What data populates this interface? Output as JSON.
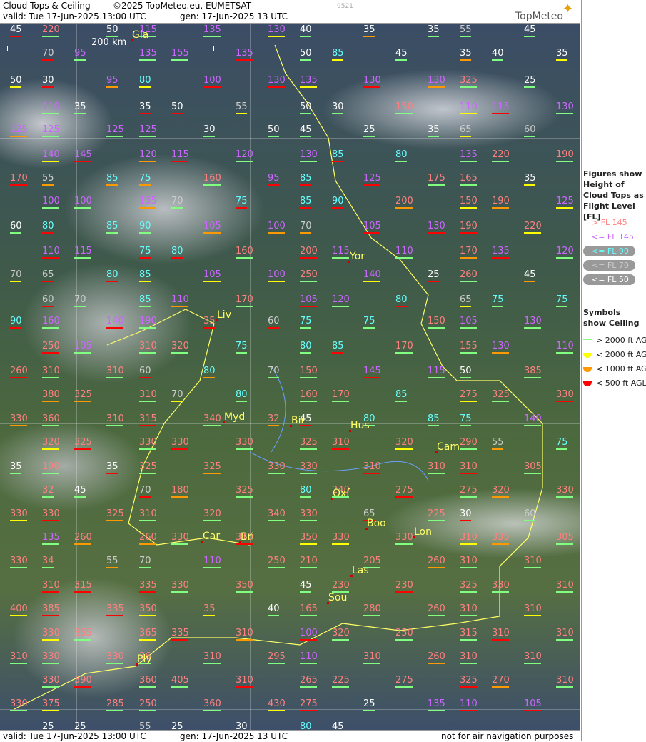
{
  "header": {
    "title": "Cloud Tops & Ceiling",
    "copyright": "©2025 TopMeteo.eu, EUMETSAT",
    "valid": "valid:  Tue  17-Jun-2025  13:00 UTC",
    "gen": "gen: 17-Jun-2025 13 UTC",
    "code": "9521",
    "brand": "TopMeteo"
  },
  "footer": {
    "valid": "valid:  Tue  17-Jun-2025  13:00 UTC",
    "gen": "gen: 17-Jun-2025 13 UTC",
    "note": "not for air navigation purposes"
  },
  "scale": {
    "label": "200 km"
  },
  "legend": {
    "figures_title": "Figures show Height of Cloud Tops as Flight Level  [FL]",
    "symbols_title": "Symbols show Ceiling",
    "fl_items": [
      {
        "label": "> FL 145",
        "color": "#ff8080"
      },
      {
        "label": "<= FL 145",
        "color": "#cc66ff"
      },
      {
        "label": "<= FL 90",
        "color": "#66ffff"
      },
      {
        "label": "<= FL 70",
        "color": "#cccccc"
      },
      {
        "label": "<= FL 50",
        "color": "#ffffff"
      }
    ],
    "ceiling_items": [
      {
        "label": "> 2000 ft AGL",
        "color": "#80ff80"
      },
      {
        "label": "< 2000 ft AGL",
        "color": "#ffff00"
      },
      {
        "label": "< 1000 ft AGL",
        "color": "#ff9900"
      },
      {
        "label": "< 500 ft AGL",
        "color": "#ff0000"
      }
    ]
  },
  "cities": [
    {
      "name": "Gla"
    },
    {
      "name": "Yor"
    },
    {
      "name": "Liv"
    },
    {
      "name": "Myd"
    },
    {
      "name": "Bir"
    },
    {
      "name": "Hus"
    },
    {
      "name": "Cam"
    },
    {
      "name": "Oxf"
    },
    {
      "name": "Car"
    },
    {
      "name": "Bri"
    },
    {
      "name": "Boo"
    },
    {
      "name": "Lon"
    },
    {
      "name": "Las"
    },
    {
      "name": "Sou"
    },
    {
      "name": "Ply"
    }
  ],
  "labels": [
    [
      "45",
      "w"
    ],
    [
      "220",
      "p"
    ],
    [
      "50",
      "w"
    ],
    [
      "115",
      "v"
    ],
    [
      "135",
      "v"
    ],
    [
      "130",
      "v"
    ],
    [
      "40",
      "w"
    ],
    [
      "35",
      "w"
    ],
    [
      "35",
      "w"
    ],
    [
      "55",
      "g"
    ],
    [
      "45",
      "w"
    ],
    [
      "70",
      "g"
    ],
    [
      "95",
      "v"
    ],
    [
      "135",
      "v"
    ],
    [
      "155",
      "v"
    ],
    [
      "135",
      "v"
    ],
    [
      "50",
      "w"
    ],
    [
      "85",
      "c"
    ],
    [
      "45",
      "w"
    ],
    [
      "35",
      "w"
    ],
    [
      "40",
      "w"
    ],
    [
      "35",
      "w"
    ],
    [
      "50",
      "w"
    ],
    [
      "30",
      "w"
    ],
    [
      "95",
      "v"
    ],
    [
      "80",
      "c"
    ],
    [
      "100",
      "v"
    ],
    [
      "130",
      "v"
    ],
    [
      "135",
      "v"
    ],
    [
      "130",
      "v"
    ],
    [
      "130",
      "v"
    ],
    [
      "325",
      "p"
    ],
    [
      "25",
      "w"
    ],
    [
      "110",
      "v"
    ],
    [
      "35",
      "w"
    ],
    [
      "35",
      "w"
    ],
    [
      "50",
      "w"
    ],
    [
      "55",
      "g"
    ],
    [
      "50",
      "w"
    ],
    [
      "30",
      "w"
    ],
    [
      "150",
      "p"
    ],
    [
      "110",
      "v"
    ],
    [
      "115",
      "v"
    ],
    [
      "130",
      "v"
    ],
    [
      "125",
      "v"
    ],
    [
      "125",
      "v"
    ],
    [
      "125",
      "v"
    ],
    [
      "125",
      "v"
    ],
    [
      "30",
      "w"
    ],
    [
      "50",
      "w"
    ],
    [
      "45",
      "w"
    ],
    [
      "25",
      "w"
    ],
    [
      "35",
      "w"
    ],
    [
      "65",
      "g"
    ],
    [
      "60",
      "g"
    ],
    [
      "140",
      "v"
    ],
    [
      "145",
      "v"
    ],
    [
      "120",
      "v"
    ],
    [
      "115",
      "v"
    ],
    [
      "120",
      "v"
    ],
    [
      "130",
      "v"
    ],
    [
      "85",
      "c"
    ],
    [
      "80",
      "c"
    ],
    [
      "135",
      "v"
    ],
    [
      "220",
      "p"
    ],
    [
      "190",
      "p"
    ],
    [
      "170",
      "p"
    ],
    [
      "55",
      "g"
    ],
    [
      "85",
      "c"
    ],
    [
      "75",
      "c"
    ],
    [
      "160",
      "p"
    ],
    [
      "95",
      "v"
    ],
    [
      "85",
      "c"
    ],
    [
      "125",
      "v"
    ],
    [
      "175",
      "p"
    ],
    [
      "165",
      "p"
    ],
    [
      "35",
      "w"
    ],
    [
      "100",
      "v"
    ],
    [
      "100",
      "v"
    ],
    [
      "135",
      "v"
    ],
    [
      "70",
      "g"
    ],
    [
      "75",
      "c"
    ],
    [
      "85",
      "c"
    ],
    [
      "90",
      "c"
    ],
    [
      "200",
      "p"
    ],
    [
      "150",
      "p"
    ],
    [
      "190",
      "p"
    ],
    [
      "125",
      "v"
    ],
    [
      "60",
      "w"
    ],
    [
      "80",
      "c"
    ],
    [
      "85",
      "c"
    ],
    [
      "90",
      "c"
    ],
    [
      "105",
      "v"
    ],
    [
      "100",
      "v"
    ],
    [
      "70",
      "g"
    ],
    [
      "105",
      "v"
    ],
    [
      "130",
      "v"
    ],
    [
      "190",
      "p"
    ],
    [
      "220",
      "p"
    ],
    [
      "110",
      "v"
    ],
    [
      "115",
      "v"
    ],
    [
      "75",
      "c"
    ],
    [
      "80",
      "c"
    ],
    [
      "160",
      "p"
    ],
    [
      "200",
      "p"
    ],
    [
      "115",
      "v"
    ],
    [
      "110",
      "v"
    ],
    [
      "170",
      "p"
    ],
    [
      "135",
      "v"
    ],
    [
      "120",
      "v"
    ],
    [
      "70",
      "g"
    ],
    [
      "65",
      "g"
    ],
    [
      "80",
      "c"
    ],
    [
      "85",
      "c"
    ],
    [
      "105",
      "v"
    ],
    [
      "100",
      "v"
    ],
    [
      "250",
      "p"
    ],
    [
      "140",
      "v"
    ],
    [
      "25",
      "w"
    ],
    [
      "260",
      "p"
    ],
    [
      "45",
      "w"
    ],
    [
      "60",
      "g"
    ],
    [
      "70",
      "g"
    ],
    [
      "85",
      "c"
    ],
    [
      "110",
      "v"
    ],
    [
      "170",
      "p"
    ],
    [
      "105",
      "v"
    ],
    [
      "120",
      "v"
    ],
    [
      "80",
      "c"
    ],
    [
      "65",
      "g"
    ],
    [
      "75",
      "c"
    ],
    [
      "75",
      "c"
    ],
    [
      "90",
      "c"
    ],
    [
      "160",
      "v"
    ],
    [
      "140",
      "v"
    ],
    [
      "190",
      "v"
    ],
    [
      "35",
      "p"
    ],
    [
      "60",
      "g"
    ],
    [
      "75",
      "c"
    ],
    [
      "75",
      "c"
    ],
    [
      "150",
      "p"
    ],
    [
      "105",
      "v"
    ],
    [
      "130",
      "v"
    ],
    [
      "250",
      "p"
    ],
    [
      "105",
      "v"
    ],
    [
      "310",
      "p"
    ],
    [
      "320",
      "p"
    ],
    [
      "75",
      "c"
    ],
    [
      "80",
      "c"
    ],
    [
      "85",
      "c"
    ],
    [
      "170",
      "p"
    ],
    [
      "155",
      "p"
    ],
    [
      "130",
      "v"
    ],
    [
      "110",
      "v"
    ],
    [
      "260",
      "p"
    ],
    [
      "310",
      "p"
    ],
    [
      "310",
      "p"
    ],
    [
      "60",
      "g"
    ],
    [
      "80",
      "c"
    ],
    [
      "70",
      "g"
    ],
    [
      "150",
      "p"
    ],
    [
      "145",
      "v"
    ],
    [
      "115",
      "v"
    ],
    [
      "50",
      "w"
    ],
    [
      "385",
      "p"
    ],
    [
      "380",
      "p"
    ],
    [
      "325",
      "p"
    ],
    [
      "310",
      "p"
    ],
    [
      "70",
      "g"
    ],
    [
      "80",
      "c"
    ],
    [
      "160",
      "p"
    ],
    [
      "170",
      "p"
    ],
    [
      "85",
      "c"
    ],
    [
      "275",
      "p"
    ],
    [
      "325",
      "p"
    ],
    [
      "330",
      "p"
    ],
    [
      "330",
      "p"
    ],
    [
      "360",
      "p"
    ],
    [
      "310",
      "p"
    ],
    [
      "315",
      "p"
    ],
    [
      "340",
      "p"
    ],
    [
      "32",
      "p"
    ],
    [
      "45",
      "w"
    ],
    [
      "80",
      "c"
    ],
    [
      "85",
      "c"
    ],
    [
      "75",
      "c"
    ],
    [
      "140",
      "v"
    ],
    [
      "320",
      "p"
    ],
    [
      "325",
      "p"
    ],
    [
      "330",
      "p"
    ],
    [
      "330",
      "p"
    ],
    [
      "330",
      "p"
    ],
    [
      "325",
      "p"
    ],
    [
      "310",
      "p"
    ],
    [
      "320",
      "p"
    ],
    [
      "290",
      "p"
    ],
    [
      "55",
      "g"
    ],
    [
      "75",
      "c"
    ],
    [
      "35",
      "w"
    ],
    [
      "190",
      "p"
    ],
    [
      "35",
      "w"
    ],
    [
      "325",
      "p"
    ],
    [
      "325",
      "p"
    ],
    [
      "330",
      "p"
    ],
    [
      "330",
      "p"
    ],
    [
      "310",
      "p"
    ],
    [
      "310",
      "p"
    ],
    [
      "310",
      "p"
    ],
    [
      "305",
      "p"
    ],
    [
      "32",
      "p"
    ],
    [
      "45",
      "w"
    ],
    [
      "70",
      "g"
    ],
    [
      "180",
      "p"
    ],
    [
      "325",
      "p"
    ],
    [
      "80",
      "c"
    ],
    [
      "240",
      "p"
    ],
    [
      "275",
      "p"
    ],
    [
      "275",
      "p"
    ],
    [
      "320",
      "p"
    ],
    [
      "330",
      "p"
    ],
    [
      "330",
      "p"
    ],
    [
      "330",
      "p"
    ],
    [
      "325",
      "p"
    ],
    [
      "310",
      "p"
    ],
    [
      "320",
      "p"
    ],
    [
      "340",
      "p"
    ],
    [
      "330",
      "p"
    ],
    [
      "65",
      "g"
    ],
    [
      "225",
      "p"
    ],
    [
      "30",
      "w"
    ],
    [
      "60",
      "g"
    ],
    [
      "135",
      "v"
    ],
    [
      "260",
      "p"
    ],
    [
      "260",
      "p"
    ],
    [
      "330",
      "p"
    ],
    [
      "310",
      "p"
    ],
    [
      "350",
      "p"
    ],
    [
      "330",
      "p"
    ],
    [
      "330",
      "p"
    ],
    [
      "310",
      "p"
    ],
    [
      "335",
      "p"
    ],
    [
      "305",
      "p"
    ],
    [
      "330",
      "p"
    ],
    [
      "34",
      "p"
    ],
    [
      "55",
      "g"
    ],
    [
      "70",
      "g"
    ],
    [
      "110",
      "v"
    ],
    [
      "250",
      "p"
    ],
    [
      "210",
      "p"
    ],
    [
      "205",
      "p"
    ],
    [
      "260",
      "p"
    ],
    [
      "310",
      "p"
    ],
    [
      "310",
      "p"
    ],
    [
      "310",
      "p"
    ],
    [
      "315",
      "p"
    ],
    [
      "335",
      "p"
    ],
    [
      "330",
      "p"
    ],
    [
      "350",
      "p"
    ],
    [
      "45",
      "w"
    ],
    [
      "230",
      "p"
    ],
    [
      "230",
      "p"
    ],
    [
      "325",
      "p"
    ],
    [
      "330",
      "p"
    ],
    [
      "310",
      "p"
    ],
    [
      "400",
      "p"
    ],
    [
      "385",
      "p"
    ],
    [
      "335",
      "p"
    ],
    [
      "350",
      "p"
    ],
    [
      "35",
      "p"
    ],
    [
      "40",
      "w"
    ],
    [
      "165",
      "p"
    ],
    [
      "280",
      "p"
    ],
    [
      "260",
      "p"
    ],
    [
      "310",
      "p"
    ],
    [
      "310",
      "p"
    ],
    [
      "330",
      "p"
    ],
    [
      "365",
      "p"
    ],
    [
      "365",
      "p"
    ],
    [
      "335",
      "p"
    ],
    [
      "310",
      "p"
    ],
    [
      "100",
      "v"
    ],
    [
      "320",
      "p"
    ],
    [
      "250",
      "p"
    ],
    [
      "315",
      "p"
    ],
    [
      "310",
      "p"
    ],
    [
      "310",
      "p"
    ],
    [
      "310",
      "p"
    ],
    [
      "330",
      "p"
    ],
    [
      "330",
      "p"
    ],
    [
      "36",
      "p"
    ],
    [
      "310",
      "p"
    ],
    [
      "295",
      "p"
    ],
    [
      "110",
      "v"
    ],
    [
      "310",
      "p"
    ],
    [
      "260",
      "p"
    ],
    [
      "310",
      "p"
    ],
    [
      "310",
      "p"
    ],
    [
      "330",
      "p"
    ],
    [
      "390",
      "p"
    ],
    [
      "360",
      "p"
    ],
    [
      "405",
      "p"
    ],
    [
      "310",
      "p"
    ],
    [
      "265",
      "p"
    ],
    [
      "225",
      "p"
    ],
    [
      "275",
      "p"
    ],
    [
      "325",
      "p"
    ],
    [
      "270",
      "p"
    ],
    [
      "310",
      "p"
    ],
    [
      "330",
      "p"
    ],
    [
      "375",
      "p"
    ],
    [
      "285",
      "p"
    ],
    [
      "250",
      "p"
    ],
    [
      "360",
      "p"
    ],
    [
      "430",
      "p"
    ],
    [
      "275",
      "p"
    ],
    [
      "25",
      "w"
    ],
    [
      "135",
      "v"
    ],
    [
      "110",
      "v"
    ],
    [
      "105",
      "v"
    ],
    [
      "25",
      "w"
    ],
    [
      "25",
      "w"
    ],
    [
      "55",
      "g"
    ],
    [
      "25",
      "w"
    ],
    [
      "30",
      "w"
    ],
    [
      "80",
      "c"
    ],
    [
      "45",
      "w"
    ]
  ]
}
